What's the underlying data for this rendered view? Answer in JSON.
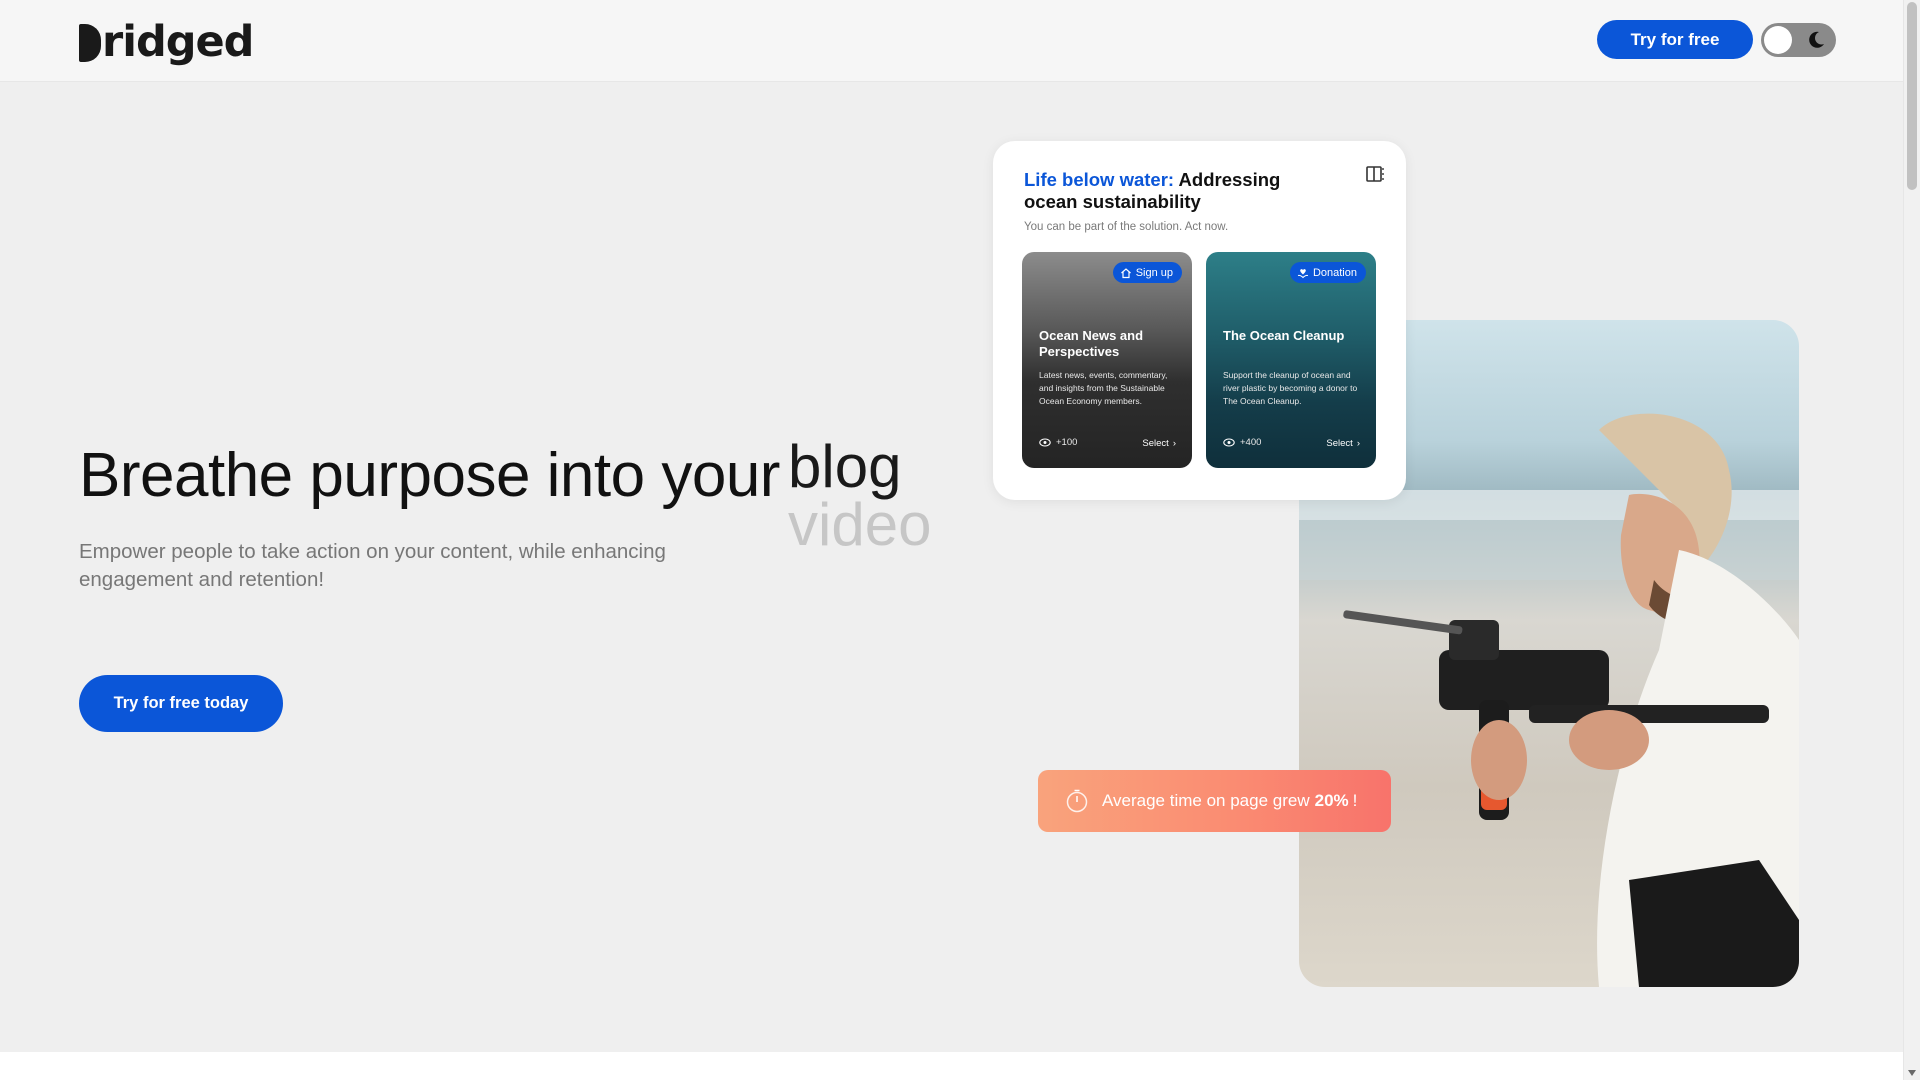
{
  "header": {
    "logo_text": "ridged",
    "cta_label": "Try for free",
    "theme_toggle_icon": "moon-icon"
  },
  "hero": {
    "title": "Breathe purpose into your",
    "rotating_words": [
      "blog",
      "video"
    ],
    "subtitle": "Empower people to take action on your content, while enhancing engagement and retention!",
    "cta_label": "Try for free today"
  },
  "card": {
    "title_highlight": "Life below water:",
    "title_rest": "Addressing ocean sustainability",
    "subtitle": "You can be part of the solution. Act now.",
    "panel_icon": "sidebar-panel-icon",
    "tiles": [
      {
        "badge": "Sign up",
        "badge_icon": "house-icon",
        "title": "Ocean News and Perspectives",
        "description": "Latest news, events, commentary, and insights from the Sustainable Ocean Economy members.",
        "views": "+100",
        "select": "Select"
      },
      {
        "badge": "Donation",
        "badge_icon": "heart-hand-icon",
        "title": "The Ocean Cleanup",
        "description": "Support the cleanup of ocean and river plastic by becoming a donor to The Ocean Cleanup.",
        "views": "+400",
        "select": "Select"
      }
    ]
  },
  "stat_banner": {
    "text": "Average time on page grew",
    "value": "20%",
    "suffix": "!",
    "icon": "timer-icon"
  },
  "colors": {
    "accent": "#0b56d8",
    "background": "#efefef",
    "stat_gradient_start": "#f9a37c",
    "stat_gradient_end": "#f8736b"
  }
}
